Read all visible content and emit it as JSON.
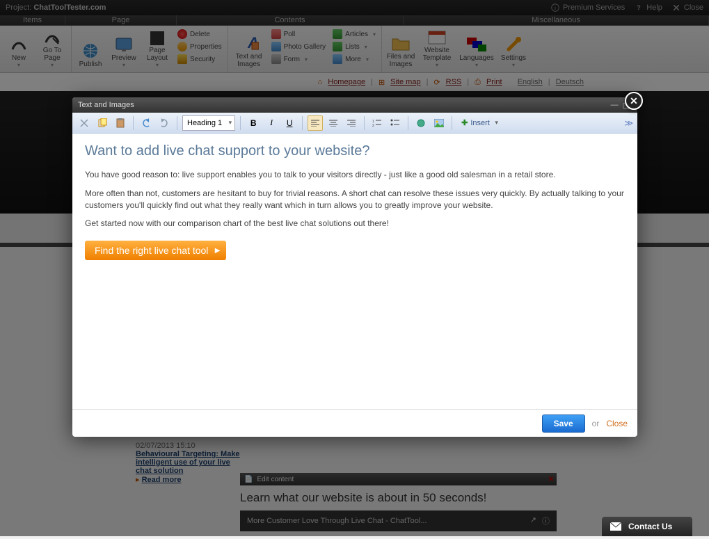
{
  "topbar": {
    "project_prefix": "Project: ",
    "project_name": "ChatToolTester.com",
    "premium": "Premium Services",
    "help": "Help",
    "close": "Close"
  },
  "groups": {
    "items": "Items",
    "page": "Page",
    "contents": "Contents",
    "misc": "Miscellaneous"
  },
  "ribbon": {
    "new": "New",
    "goto": "Go To Page",
    "publish": "Publish",
    "preview": "Preview",
    "layout": "Page Layout",
    "delete": "Delete",
    "properties": "Properties",
    "security": "Security",
    "textimages": "Text and Images",
    "poll": "Poll",
    "gallery": "Photo Gallery",
    "form": "Form",
    "articles": "Articles",
    "lists": "Lists",
    "more": "More",
    "files": "Files and Images",
    "template": "Website Template",
    "languages": "Languages",
    "settings": "Settings"
  },
  "linkbar": {
    "homepage": "Homepage",
    "sitemap": "Site map",
    "rss": "RSS",
    "print": "Print",
    "english": "English",
    "deutsch": "Deutsch"
  },
  "news": {
    "date": "02/07/2013 15:10",
    "title": "Behavioural Targeting: Make intelligent use of your live chat solution",
    "readmore": "Read more"
  },
  "editbar": "Edit content",
  "learn": "Learn what our website is about in 50 seconds!",
  "video_title": "More Customer Love Through Live Chat - ChatTool...",
  "modal": {
    "title": "Text and Images",
    "style": "Heading 1",
    "insert": "Insert",
    "h1": "Want to add live chat support to your website?",
    "p1": "You have good reason to: live support enables you to talk to your visitors directly - just like a good old salesman in a retail store.",
    "p2": "More often than not, customers are hesitant to buy for trivial reasons. A short chat can resolve these issues very quickly. By actually talking to your customers you'll quickly find out what they really want which in turn allows you to greatly improve your website.",
    "p3": "Get started now with our comparison chart of the best live chat solutions out there!",
    "cta": "Find the right live chat tool",
    "save": "Save",
    "or": "or",
    "close": "Close"
  },
  "contact": "Contact Us"
}
